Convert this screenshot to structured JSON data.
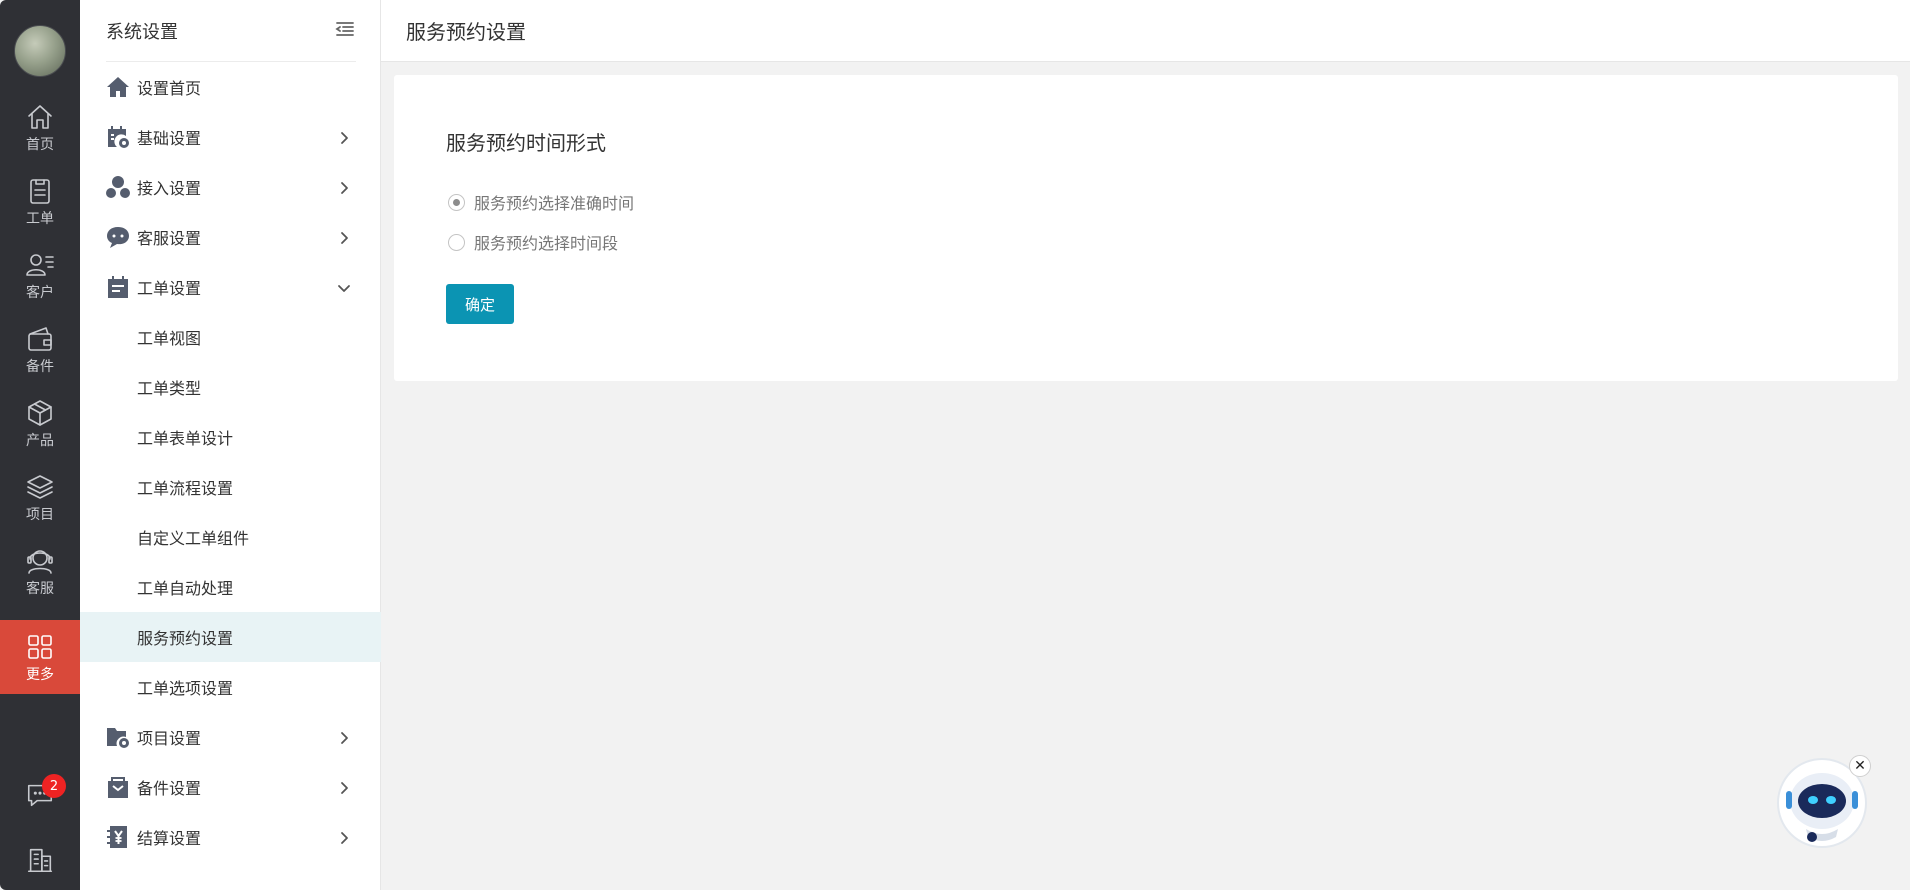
{
  "rail": {
    "items": [
      {
        "label": "首页",
        "icon": "home-icon"
      },
      {
        "label": "工单",
        "icon": "clipboard-icon"
      },
      {
        "label": "客户",
        "icon": "user-list-icon"
      },
      {
        "label": "备件",
        "icon": "wallet-icon"
      },
      {
        "label": "产品",
        "icon": "box-icon"
      },
      {
        "label": "项目",
        "icon": "layers-icon"
      },
      {
        "label": "客服",
        "icon": "headset-icon"
      },
      {
        "label": "更多",
        "icon": "grid-icon",
        "active": true
      }
    ],
    "message_badge": "2",
    "active_color": "#d9493a"
  },
  "sidebar": {
    "title": "系统设置",
    "menu": [
      {
        "label": "设置首页",
        "icon": "house-icon"
      },
      {
        "label": "基础设置",
        "icon": "calendar-gear-icon",
        "arrow": "right"
      },
      {
        "label": "接入设置",
        "icon": "connect-icon",
        "arrow": "right"
      },
      {
        "label": "客服设置",
        "icon": "chat-bubble-icon",
        "arrow": "right"
      },
      {
        "label": "工单设置",
        "icon": "ticket-calendar-icon",
        "arrow": "down"
      },
      {
        "label": "项目设置",
        "icon": "folder-gear-icon",
        "arrow": "right"
      },
      {
        "label": "备件设置",
        "icon": "parts-box-icon",
        "arrow": "right"
      },
      {
        "label": "结算设置",
        "icon": "yen-notebook-icon",
        "arrow": "right"
      }
    ],
    "ticket_submenu": [
      {
        "label": "工单视图"
      },
      {
        "label": "工单类型"
      },
      {
        "label": "工单表单设计"
      },
      {
        "label": "工单流程设置"
      },
      {
        "label": "自定义工单组件"
      },
      {
        "label": "工单自动处理"
      },
      {
        "label": "服务预约设置",
        "selected": true
      },
      {
        "label": "工单选项设置"
      }
    ]
  },
  "main": {
    "page_title": "服务预约设置",
    "section_title": "服务预约时间形式",
    "options": [
      {
        "label": "服务预约选择准确时间",
        "checked": true
      },
      {
        "label": "服务预约选择时间段",
        "checked": false
      }
    ],
    "confirm_label": "确定",
    "accent_color": "#0b94b3"
  },
  "assistant": {
    "close_symbol": "✕"
  }
}
